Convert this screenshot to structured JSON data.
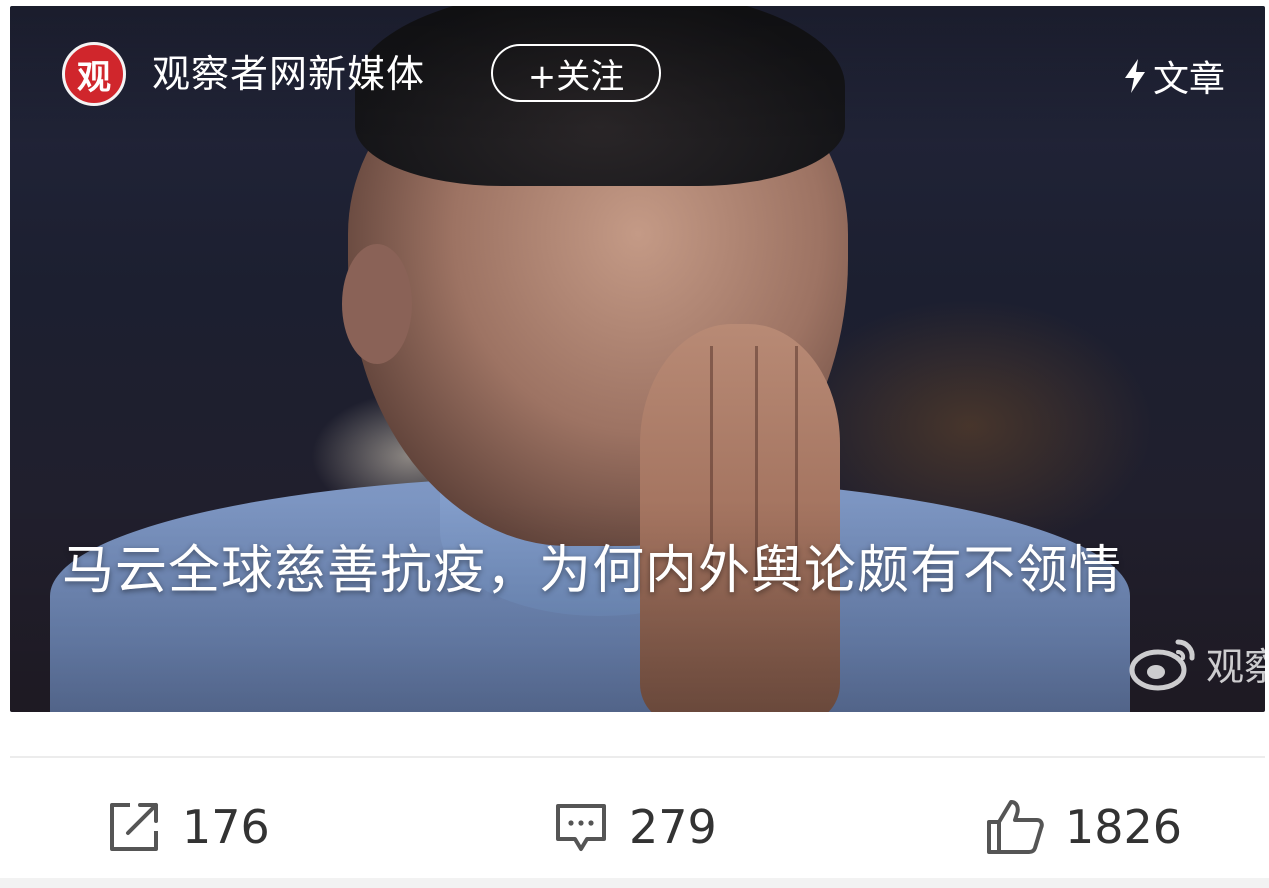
{
  "card": {
    "account_name": "观察者网新媒体",
    "follow_label": "+关注",
    "logo_glyph": "观",
    "type_label": "文章",
    "headline": "马云全球慈善抗疫，为何内外舆论颇有不领情",
    "watermark": "观察",
    "brand_color": "#d0262c"
  },
  "actions": {
    "share_count": "176",
    "comment_count": "279",
    "like_count": "1826"
  },
  "icons": [
    "share-icon",
    "comment-icon",
    "like-icon",
    "lightning-icon",
    "weibo-icon"
  ]
}
